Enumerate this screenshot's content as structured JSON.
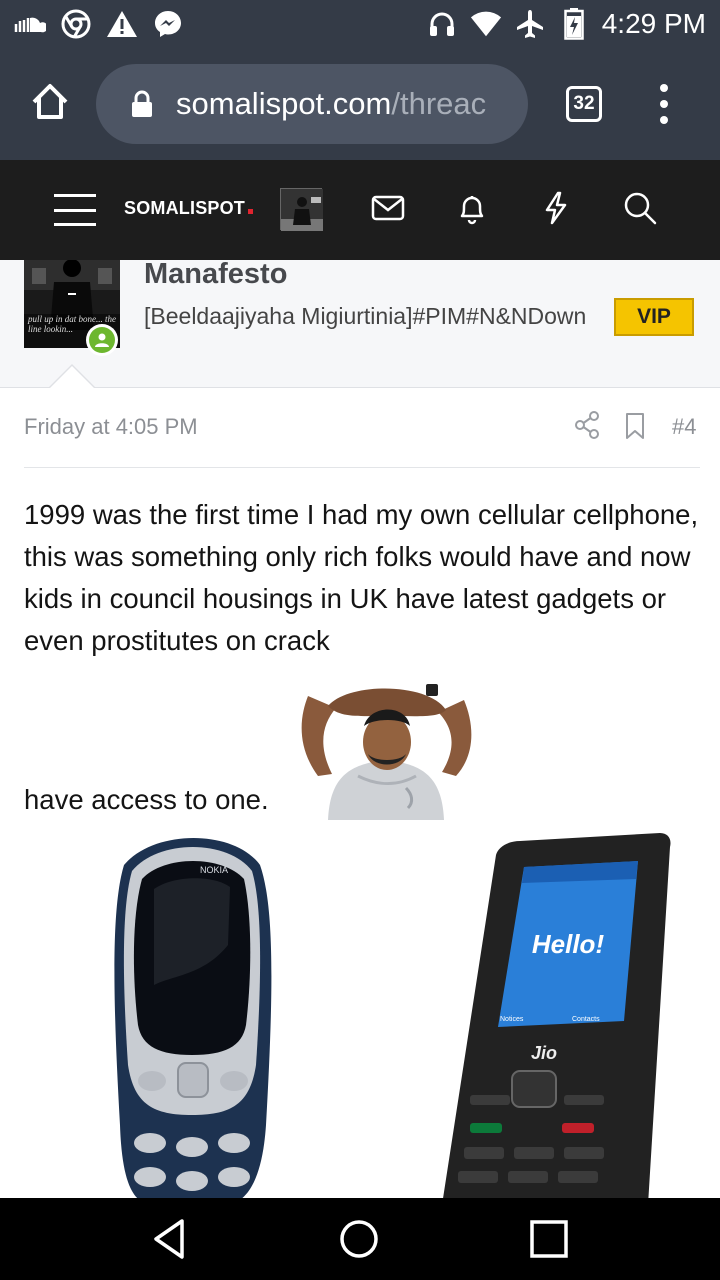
{
  "status_bar": {
    "time": "4:29 PM",
    "left_icons": [
      "soundcloud-icon",
      "chrome-icon",
      "warning-icon",
      "messenger-icon"
    ],
    "right_icons": [
      "headphones-icon",
      "wifi-icon",
      "airplane-icon",
      "battery-charging-icon"
    ]
  },
  "browser": {
    "url_host": "somalispot.com",
    "url_path": "/threac",
    "tab_count": "32"
  },
  "site_nav": {
    "brand": "SOMALISPOT",
    "icons": [
      "menu-icon",
      "avatar",
      "mail-icon",
      "bell-icon",
      "bolt-icon",
      "search-icon"
    ]
  },
  "post": {
    "username": "Manafesto",
    "user_title": "[Beeldaajiyaha Migiurtinia]#PIM#N&NDown",
    "badge": "VIP",
    "avatar_caption": "pull up in dat bone... the line lookin...",
    "date": "Friday at 4:05 PM",
    "post_number": "#4",
    "body": "1999 was the first time I had my own cellular cellphone, this was something only rich folks would have and now kids in council housings in UK have latest gadgets or even prostitutes on crack",
    "body_end": "have access to one.",
    "image_texts": {
      "nokia_brand": "NOKIA",
      "jio_screen": "Hello!",
      "jio_brand": "Jio",
      "jio_notices": "Notices",
      "jio_contacts": "Contacts"
    }
  },
  "colors": {
    "chrome_bg": "#343b47",
    "site_nav_bg": "#1d1d1d",
    "vip_badge": "#f5c400",
    "online_dot": "#6db72f",
    "brand_dot": "#e0242f"
  },
  "android_nav": [
    "back-icon",
    "home-icon",
    "recents-icon"
  ]
}
